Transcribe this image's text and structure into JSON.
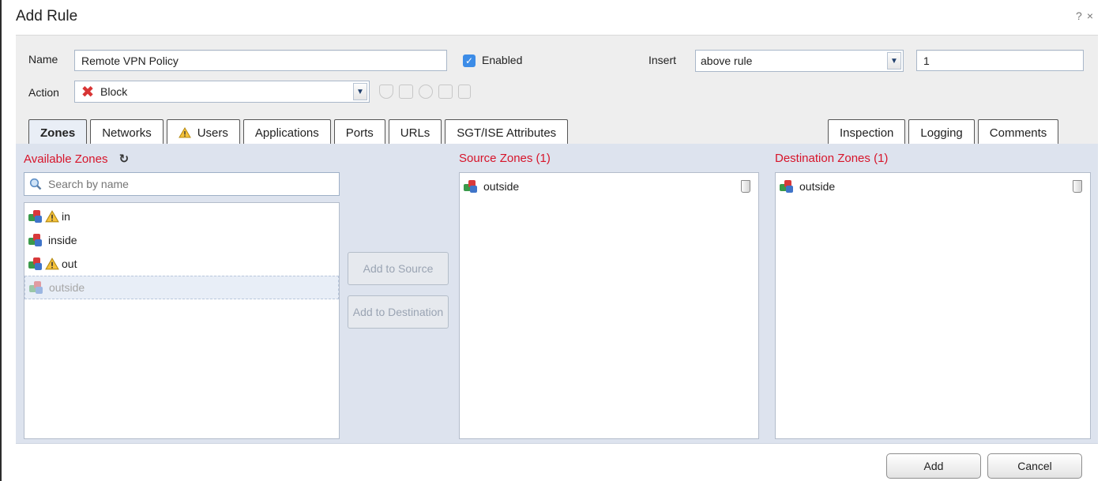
{
  "dialog": {
    "title": "Add Rule",
    "help_icon": "?",
    "close_icon": "×"
  },
  "form": {
    "name_label": "Name",
    "name_value": "Remote VPN Policy",
    "enabled_label": "Enabled",
    "enabled_checked": true,
    "insert_label": "Insert",
    "insert_value": "above rule",
    "insert_number": "1",
    "action_label": "Action",
    "action_value": "Block",
    "action_icons": [
      "shield-icon",
      "copy-icon",
      "user-search-icon",
      "folder-icon",
      "document-icon"
    ]
  },
  "tabs": {
    "left": [
      {
        "label": "Zones",
        "active": true
      },
      {
        "label": "Networks"
      },
      {
        "label": "Users",
        "warning": true
      },
      {
        "label": "Applications"
      },
      {
        "label": "Ports"
      },
      {
        "label": "URLs"
      },
      {
        "label": "SGT/ISE Attributes"
      }
    ],
    "right": [
      {
        "label": "Inspection"
      },
      {
        "label": "Logging"
      },
      {
        "label": "Comments"
      }
    ]
  },
  "available": {
    "title": "Available Zones",
    "search_placeholder": "Search by name",
    "items": [
      {
        "label": "in",
        "warning": true
      },
      {
        "label": "inside"
      },
      {
        "label": "out",
        "warning": true
      },
      {
        "label": "outside",
        "disabled": true
      }
    ]
  },
  "buttons": {
    "add_to_source": "Add to Source",
    "add_to_destination": "Add to Destination",
    "add": "Add",
    "cancel": "Cancel"
  },
  "source": {
    "title": "Source Zones (1)",
    "items": [
      {
        "label": "outside"
      }
    ]
  },
  "destination": {
    "title": "Destination Zones (1)",
    "items": [
      {
        "label": "outside"
      }
    ]
  },
  "colors": {
    "section_title": "#d7142a",
    "content_bg": "#dde3ee",
    "checkbox": "#3c8ce7"
  }
}
